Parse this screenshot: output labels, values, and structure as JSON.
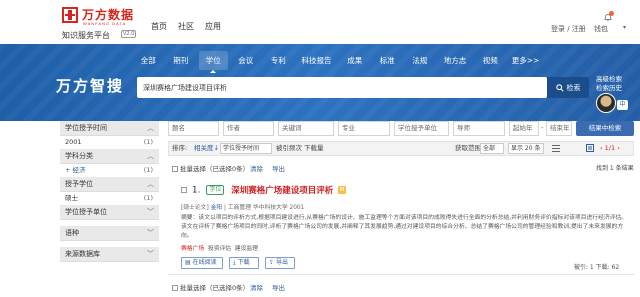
{
  "header": {
    "logo_cn": "万方数据",
    "logo_en": "WANFANG DATA",
    "platform": "知识服务平台",
    "version_tag": "V2.0",
    "nav": [
      "首页",
      "社区",
      "应用"
    ],
    "login": "登录 / 注册",
    "wallet": "钱包",
    "caret": "▾"
  },
  "banner": {
    "tabs": [
      "全部",
      "期刊",
      "学位",
      "会议",
      "专利",
      "科技报告",
      "成果",
      "标准",
      "法规",
      "地方志",
      "视频",
      "更多>>"
    ],
    "active_tab": "学位",
    "brand": "万方智搜",
    "search_query": "深圳赛格广场建设项目评析",
    "search_button": "检索",
    "side_links": [
      "高级检索",
      "检索历史"
    ],
    "avatar_badge": "中"
  },
  "sidebar": {
    "sections": [
      {
        "title": "学位授予时间",
        "rows": [
          {
            "label": "2001",
            "count": "(1)"
          }
        ]
      },
      {
        "title": "学科分类",
        "rows": [
          {
            "label": "+ 经济",
            "count": "(1)"
          }
        ]
      },
      {
        "title": "授予学位",
        "rows": [
          {
            "label": "硕士",
            "count": "(1)"
          }
        ]
      },
      {
        "title": "学位授予单位",
        "rows": []
      },
      {
        "title": "语种",
        "rows": []
      },
      {
        "title": "来源数据库",
        "rows": []
      }
    ]
  },
  "filters": {
    "fields": [
      "题名",
      "作者",
      "关键词",
      "专业",
      "学位授予单位",
      "导师",
      "起始年",
      "结束年"
    ],
    "button": "结果中检索"
  },
  "sortbar": {
    "sort_label": "排序:",
    "sort_options": [
      "相关度",
      "学位授予时间",
      "被引频次",
      "下载量"
    ],
    "fulltext": "获取范围",
    "fulltext_value": "全部",
    "per_page": "显示 20 条",
    "pager": "1/1",
    "found": "找到 1 条结果"
  },
  "select_row": {
    "batch_select": "批量选择（已选择0条）",
    "clear": "清除",
    "export": "导出"
  },
  "result": {
    "index": "1.",
    "period_tag": "学位",
    "title": "深圳赛格广场建设项目评析",
    "m_tag": "M",
    "meta_degree": "[硕士论文]",
    "meta_author": "金阳",
    "meta_major": "工商管理",
    "meta_school": "华中科技大学",
    "meta_year": "2001",
    "abstract_1": "摘要：该文以项目的评析方式,根据项目建设进行,从赛格广场的设计、施工监理等个方面对该项目的成败得失进行全面的分析总结,并利用财务评价指标对该项目进行经济评估。",
    "abstract_2": "该文在评析了赛格广场项目的同时,评析了赛格广场公司的发展,并阐释了其发展趋势,通过对建设项目的综合分析、总结了赛格广场公司的管理经验和教训,提出了未来发展的方向。",
    "keywords": [
      "赛格广场",
      "投资评估",
      "建设监理"
    ],
    "actions": [
      "在线阅读",
      "下载",
      "导出"
    ],
    "stats": "被引: 1    下载: 62"
  },
  "bottom": {
    "batch_select": "批量选择（已选择0条）",
    "clear": "清除",
    "export": "导出"
  }
}
